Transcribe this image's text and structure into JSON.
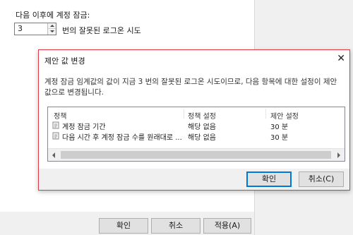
{
  "background": {
    "setting_label": "다음 이후에 계정 잠금:",
    "spin_value": "3",
    "spin_suffix": "번의 잘못된 로그온 시도",
    "buttons": {
      "ok": "확인",
      "cancel": "취소",
      "apply": "적용(A)"
    }
  },
  "dialog": {
    "title": "제안 값 변경",
    "close_glyph": "✕",
    "message": "계정 잠금 임계값의 값이 지금 3 번의 잘못된 로그온 시도이므로, 다음 항목에 대한 설정이 제안 값으로 변경됩니다.",
    "columns": [
      "정책",
      "정책 설정",
      "제안 설정"
    ],
    "rows": [
      {
        "policy": "계정 잠금 기간",
        "setting": "해당 없음",
        "suggested": "30 분"
      },
      {
        "policy": "다음 시간 후 계정 잠금 수를 원래대로 ...",
        "setting": "해당 없음",
        "suggested": "30 분"
      }
    ],
    "ok_label": "확인",
    "cancel_label": "취소(C)"
  },
  "colors": {
    "dialog_border": "#e0394a",
    "default_button_border": "#0078d7"
  },
  "icons": [
    "policy-icon",
    "close-icon",
    "spin-up-icon",
    "spin-down-icon",
    "scroll-left-icon",
    "scroll-right-icon"
  ]
}
